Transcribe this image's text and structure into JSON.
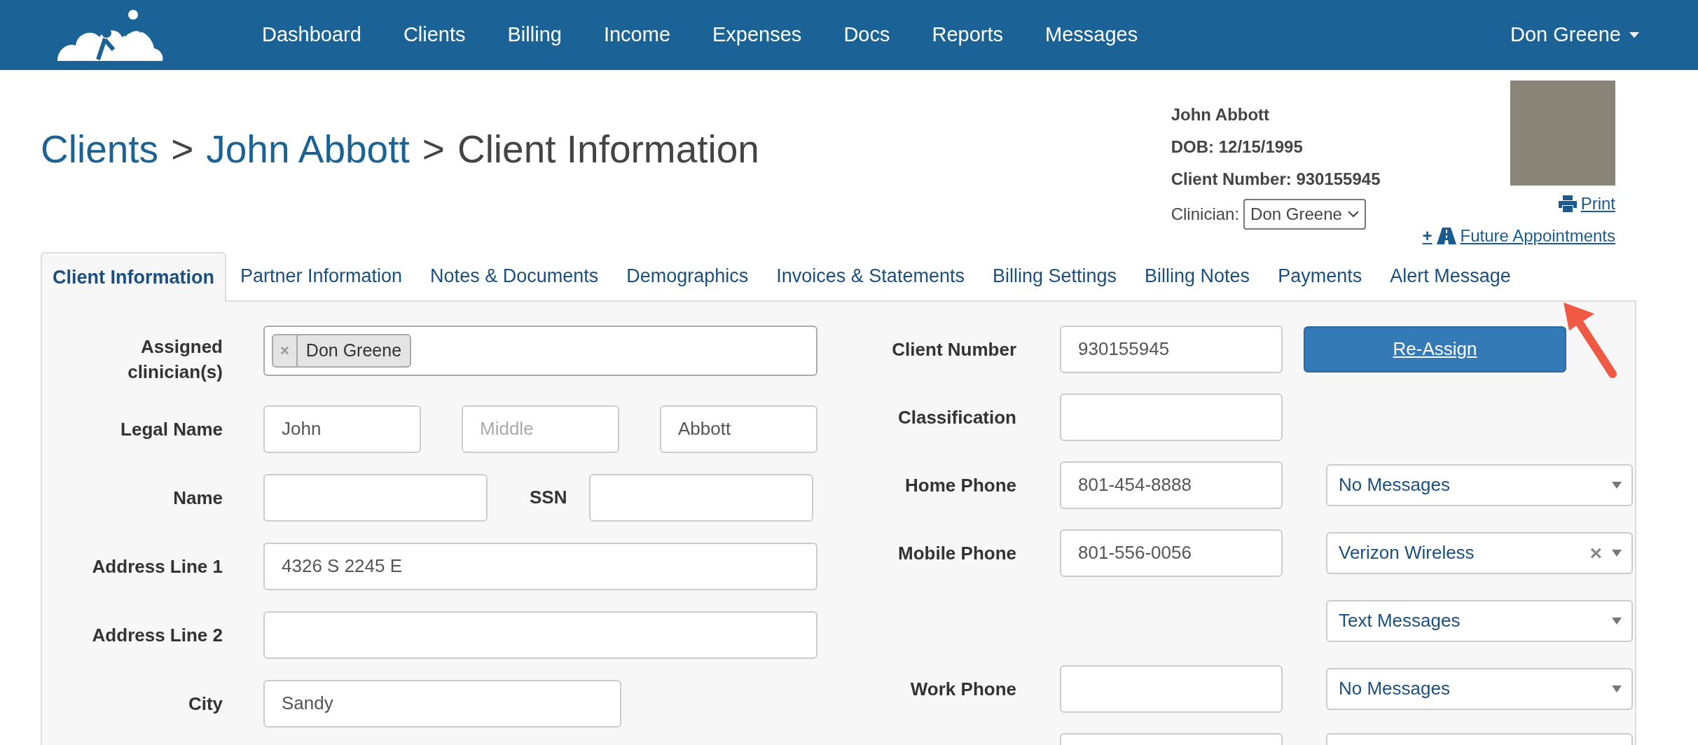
{
  "nav": {
    "items": [
      "Dashboard",
      "Clients",
      "Billing",
      "Income",
      "Expenses",
      "Docs",
      "Reports",
      "Messages"
    ],
    "user": "Don Greene"
  },
  "breadcrumb": [
    {
      "kind": "link",
      "text": "Clients"
    },
    {
      "kind": "sep",
      "text": ">"
    },
    {
      "kind": "link",
      "text": "John Abbott"
    },
    {
      "kind": "sep",
      "text": ">"
    },
    {
      "kind": "current",
      "text": "Client Information"
    }
  ],
  "client_summary": {
    "name": "John Abbott",
    "dob": "DOB: 12/15/1995",
    "client_number": "Client Number: 930155945",
    "clinician_label": "Clinician:",
    "clinician_value": "Don Greene",
    "print": "Print",
    "future_plus": "+",
    "future_appointments": "Future Appointments"
  },
  "tabs": [
    {
      "label": "Client Information",
      "selected": true
    },
    {
      "label": "Partner Information",
      "selected": false
    },
    {
      "label": "Notes & Documents",
      "selected": false
    },
    {
      "label": "Demographics",
      "selected": false
    },
    {
      "label": "Invoices & Statements",
      "selected": false
    },
    {
      "label": "Billing Settings",
      "selected": false
    },
    {
      "label": "Billing Notes",
      "selected": false
    },
    {
      "label": "Payments",
      "selected": false
    },
    {
      "label": "Alert Message",
      "selected": false
    }
  ],
  "left_rows": [
    {
      "kind": "tags",
      "label": "Assigned clinician(s)",
      "tags": [
        {
          "remove": "×",
          "label": "Don Greene"
        }
      ]
    },
    {
      "kind": "triple",
      "label": "Legal Name",
      "fields": [
        {
          "value": "John"
        },
        {
          "placeholder": "Middle"
        },
        {
          "value": "Abbott"
        }
      ]
    },
    {
      "kind": "pair",
      "label": "Name",
      "label2": "SSN"
    },
    {
      "kind": "full",
      "label": "Address Line 1",
      "value": "4326 S 2245 E"
    },
    {
      "kind": "full",
      "label": "Address Line 2"
    },
    {
      "kind": "half",
      "label": "City",
      "value": "Sandy"
    }
  ],
  "right_rows": [
    {
      "kind": "button",
      "label": "Client Number",
      "value": "930155945",
      "button": "Re-Assign"
    },
    {
      "kind": "field",
      "label": "Classification"
    },
    {
      "kind": "select",
      "label": "Home Phone",
      "value": "801-454-8888",
      "select": "No Messages"
    },
    {
      "kind": "select",
      "label": "Mobile Phone",
      "value": "801-556-0056",
      "select": "Verizon Wireless",
      "clear": "×"
    },
    {
      "kind": "select_only",
      "select": "Text Messages"
    },
    {
      "kind": "select",
      "label": "Work Phone",
      "select": "No Messages"
    },
    {
      "kind": "cut"
    }
  ]
}
